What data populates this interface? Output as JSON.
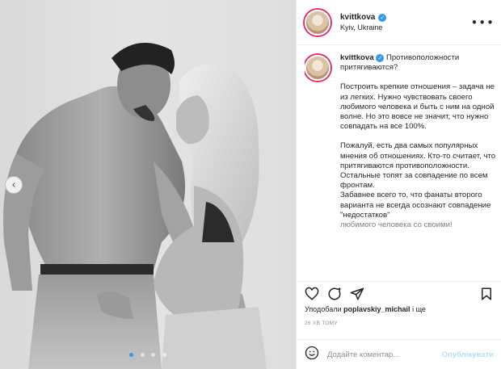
{
  "post": {
    "username": "kvittkova",
    "location": "Kyiv, Ukraine",
    "more_glyph": "•••",
    "verified_glyph": "✓"
  },
  "caption": {
    "title": "Противоположности притягиваются?",
    "paragraphs": [
      "Построить крепкие отношения – задача не из легких. Нужно чувствовать своего любимого человека и быть с ним на одной волне. Но это вовсе не значит, что нужно совпадать на все 100%.",
      "Пожалуй, есть два самых популярных мнения об отношениях. Кто-то считает, что притягиваются противоположности. Остальные топят за совпадение по всем фронтам.",
      "Забавнее всего то, что фанаты второго варианта не всегда осознают совпадение \"недостатков\"",
      "любимого человека со своими!"
    ]
  },
  "likes": {
    "prefix": "Уподобали",
    "user": "poplavskiy_michail",
    "suffix": "і ще"
  },
  "timestamp": "26 ХВ ТОМУ",
  "comment": {
    "placeholder": "Додайте коментар...",
    "post_label": "Опублікувати"
  },
  "carousel": {
    "prev_glyph": "‹",
    "total": 4,
    "active_index": 0
  },
  "colors": {
    "accent": "#3897f0",
    "post_button_disabled": "#b2dffc",
    "story_ring": "#e1306c",
    "muted_text": "#8e8e8e"
  },
  "icons": [
    "heart-icon",
    "comment-icon",
    "share-icon",
    "bookmark-icon",
    "emoji-icon"
  ]
}
